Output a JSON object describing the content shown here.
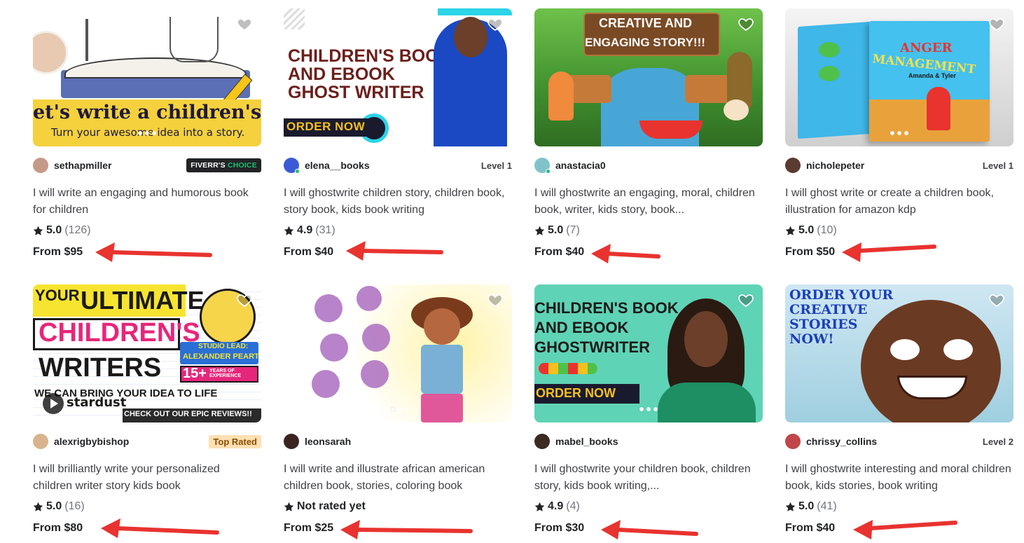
{
  "gigs": [
    {
      "seller": "sethapmiller",
      "badge": "FIVERR'S",
      "badge_accent": "CHOICE",
      "title": "I will write an engaging and humorous book for children",
      "score": "5.0",
      "count": "(126)",
      "price": "From $95",
      "thumb": {
        "line1": "et's write a children's book!",
        "line2": "Turn your awesome idea into a story."
      }
    },
    {
      "seller": "elena__books",
      "badge": "Level 1",
      "title": "I will ghostwrite children story, children book, story book, kids book writing",
      "score": "4.9",
      "count": "(31)",
      "price": "From $40",
      "thumb": {
        "line1": "CHILDREN'S BOOK",
        "line2": "AND EBOOK",
        "line3": "GHOST WRITER",
        "cta": "ORDER NOW"
      }
    },
    {
      "seller": "anastacia0",
      "badge": "",
      "title": "I will ghostwrite an engaging, moral, children book, writer, kids story, book...",
      "score": "5.0",
      "count": "(7)",
      "price": "From $40",
      "thumb": {
        "line1": "CREATIVE AND",
        "line2": "ENGAGING STORY!!!"
      }
    },
    {
      "seller": "nicholepeter",
      "badge": "Level 1",
      "title": "I will ghost write or create a children book, illustration for amazon kdp",
      "score": "5.0",
      "count": "(10)",
      "price": "From $50",
      "thumb": {
        "line1": "ANGER",
        "line2": "MANAGEMENT",
        "line3": "Amanda & Tyler"
      }
    },
    {
      "seller": "alexrigbybishop",
      "badge": "Top Rated",
      "title": "I will brilliantly write your personalized children writer story kids book",
      "score": "5.0",
      "count": "(16)",
      "price": "From $80",
      "thumb": {
        "line1": "YOUR",
        "line1b": "ULTIMATE",
        "line2": "CHILDREN'S",
        "line3": "WRITERS",
        "line4": "WE CAN BRING YOUR IDEA TO LIFE",
        "studio1": "STUDIO LEAD:",
        "studio2": "ALEXANDER PEART",
        "years": "15+",
        "years_label": "YEARS OF EXPERIENCE",
        "brand": "stardust",
        "reviews": "CHECK OUT OUR EPIC REVIEWS!!"
      }
    },
    {
      "seller": "leonsarah",
      "badge": "",
      "title": "I will write and illustrate african american children book, stories, coloring book",
      "score": "Not rated yet",
      "count": "",
      "price": "From $25",
      "thumb": {}
    },
    {
      "seller": "mabel_books",
      "badge": "",
      "title": "I will ghostwrite your children book, children story, kids book writing,...",
      "score": "4.9",
      "count": "(4)",
      "price": "From $30",
      "thumb": {
        "line1": "CHILDREN'S BOOK",
        "line2": "AND EBOOK",
        "line3": "GHOSTWRITER",
        "cta": "ORDER NOW"
      }
    },
    {
      "seller": "chrissy_collins",
      "badge": "Level 2",
      "title": "I will ghostwrite interesting and moral children book, kids stories, book writing",
      "score": "5.0",
      "count": "(41)",
      "price": "From $40",
      "thumb": {
        "line1": "ORDER YOUR",
        "line2": "CREATIVE",
        "line3": "STORIES",
        "line4": "NOW!"
      }
    }
  ],
  "colors": {
    "accent_green": "#1dbf73",
    "arrow_red": "#e8332f",
    "text_dark": "#222325",
    "text_muted": "#74767e"
  }
}
